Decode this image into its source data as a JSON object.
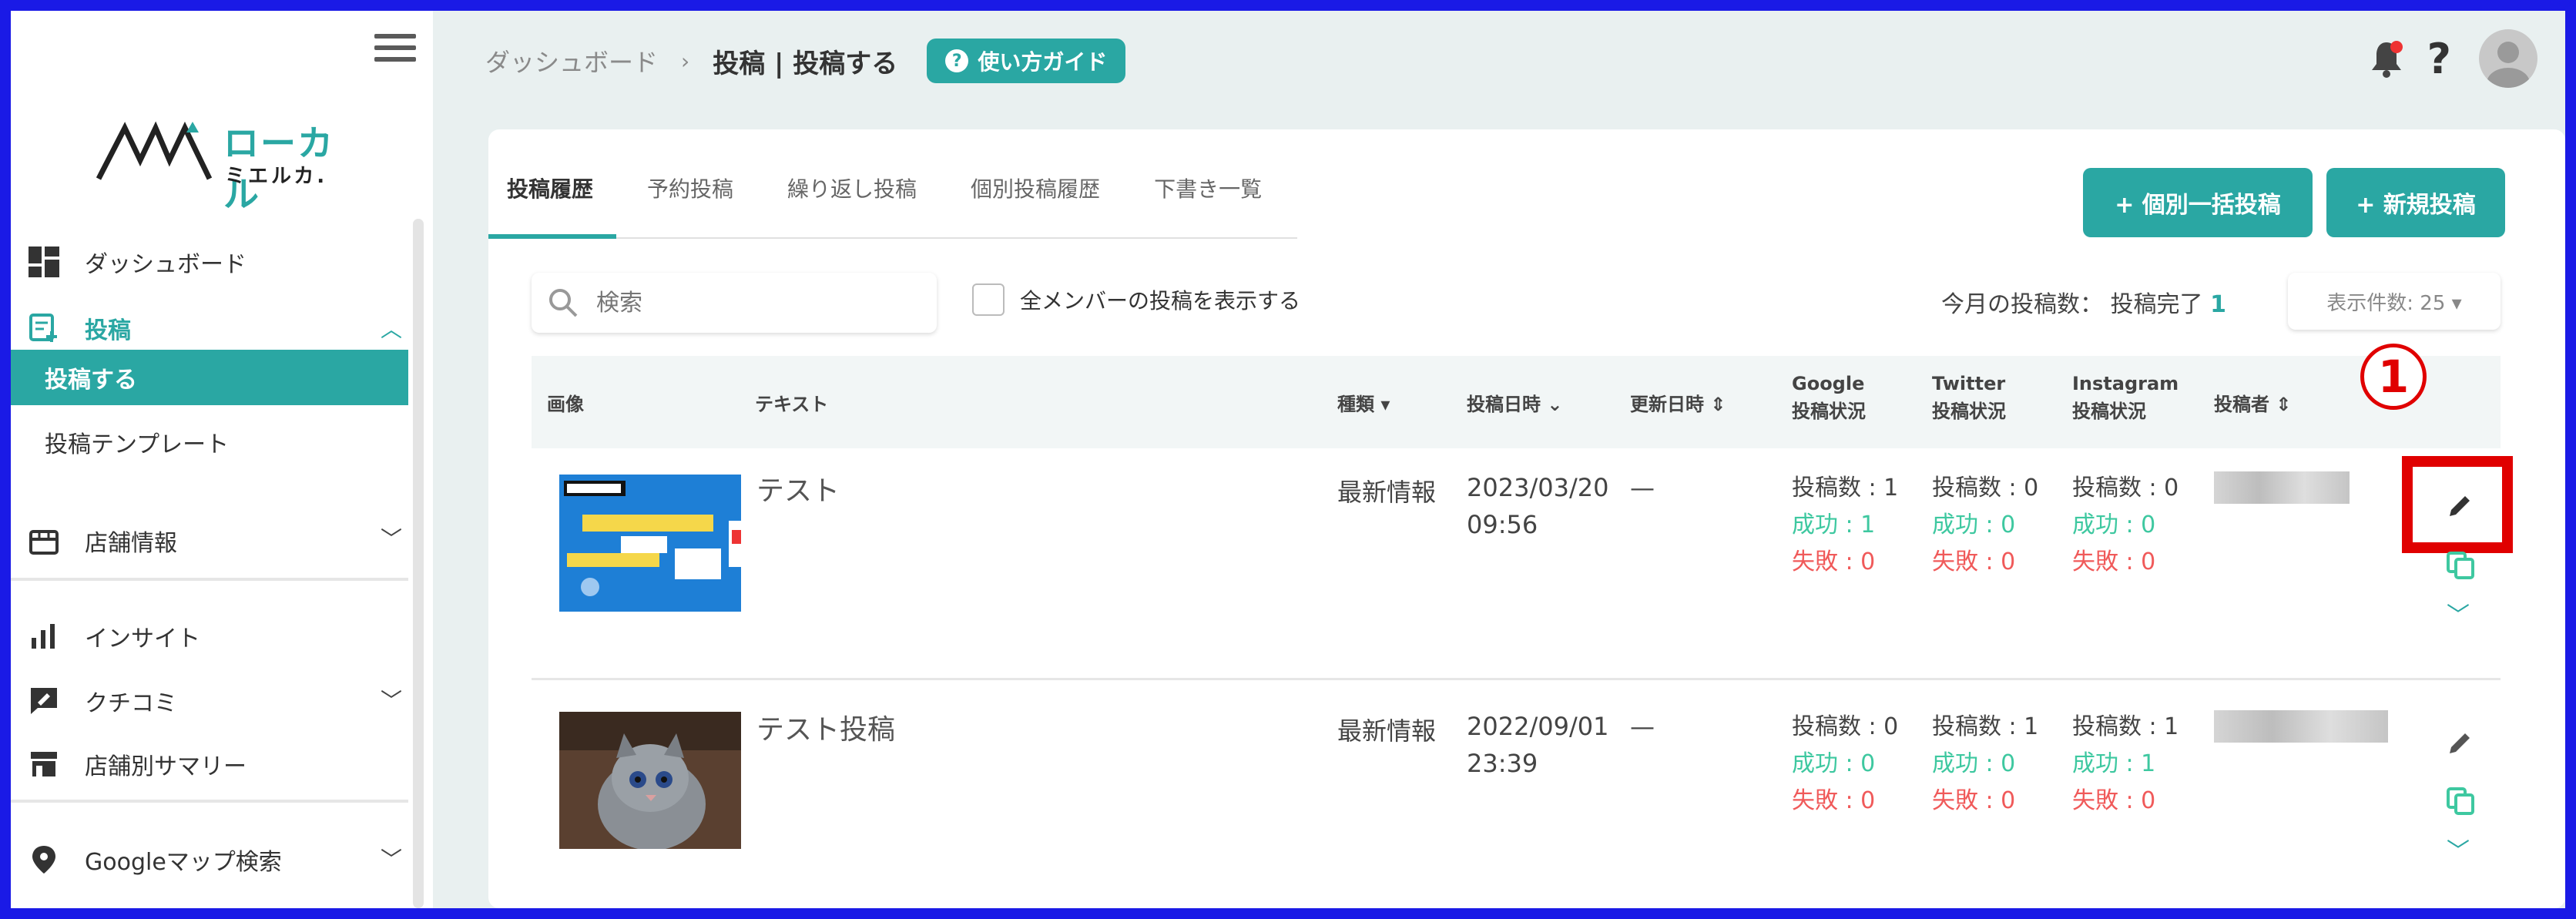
{
  "header": {
    "breadcrumb_root": "ダッシュボード",
    "breadcrumb_sep": "›",
    "breadcrumb_current": "投稿 | 投稿する",
    "guide_label": "使い方ガイド"
  },
  "logo": {
    "main": "ローカル",
    "sub": "ミエルカ."
  },
  "sidebar": {
    "items": [
      {
        "label": "ダッシュボード",
        "icon": "dashboard-icon"
      },
      {
        "label": "投稿",
        "icon": "post-icon"
      },
      {
        "label": "店舗情報",
        "icon": "store-icon"
      },
      {
        "label": "インサイト",
        "icon": "insight-icon"
      },
      {
        "label": "クチコミ",
        "icon": "review-icon"
      },
      {
        "label": "店舗別サマリー",
        "icon": "store-summary-icon"
      },
      {
        "label": "Googleマップ検索",
        "icon": "map-pin-icon"
      }
    ],
    "sub_active": "投稿する",
    "sub_template": "投稿テンプレート"
  },
  "tabs": [
    "投稿履歴",
    "予約投稿",
    "繰り返し投稿",
    "個別投稿履歴",
    "下書き一覧"
  ],
  "buttons": {
    "bulk": "+ 個別一括投稿",
    "new": "+ 新規投稿"
  },
  "search": {
    "placeholder": "検索"
  },
  "filter": {
    "show_all_members": "全メンバーの投稿を表示する"
  },
  "month_count": {
    "label": "今月の投稿数： 投稿完了",
    "value": "1"
  },
  "per_page": "表示件数: 25 ▾",
  "table": {
    "headers": {
      "image": "画像",
      "text": "テキスト",
      "type": "種類 ▾",
      "post_date": "投稿日時 ⌄",
      "updated": "更新日時 ⇕",
      "google_1": "Google",
      "google_2": "投稿状況",
      "twitter_1": "Twitter",
      "twitter_2": "投稿状況",
      "instagram_1": "Instagram",
      "instagram_2": "投稿状況",
      "author": "投稿者 ⇕"
    },
    "rows": [
      {
        "text": "テスト",
        "type": "最新情報",
        "date": "2023/03/20",
        "time": "09:56",
        "updated": "—",
        "google": {
          "total": "投稿数 : 1",
          "ok": "成功 : 1",
          "ng": "失敗 : 0"
        },
        "twitter": {
          "total": "投稿数 : 0",
          "ok": "成功 : 0",
          "ng": "失敗 : 0"
        },
        "instagram": {
          "total": "投稿数 : 0",
          "ok": "成功 : 0",
          "ng": "失敗 : 0"
        }
      },
      {
        "text": "テスト投稿",
        "type": "最新情報",
        "date": "2022/09/01",
        "time": "23:39",
        "updated": "—",
        "google": {
          "total": "投稿数 : 0",
          "ok": "成功 : 0",
          "ng": "失敗 : 0"
        },
        "twitter": {
          "total": "投稿数 : 1",
          "ok": "成功 : 0",
          "ng": "失敗 : 0"
        },
        "instagram": {
          "total": "投稿数 : 1",
          "ok": "成功 : 1",
          "ng": "失敗 : 0"
        }
      }
    ]
  },
  "annotation": {
    "step": "1"
  },
  "colors": {
    "accent": "#2aa7a3",
    "success": "#3ec8a0",
    "fail": "#f05a5a",
    "highlight": "#e00000"
  }
}
